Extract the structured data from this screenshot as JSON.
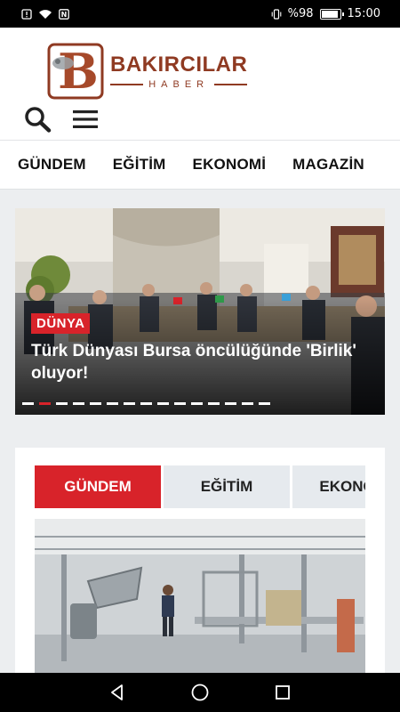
{
  "status_bar": {
    "battery": "%98",
    "time": "15:00"
  },
  "header": {
    "logo_letter": "B",
    "logo_name": "BAKIRCILAR",
    "logo_sub": "HABER"
  },
  "category_nav": {
    "items": [
      "GÜNDEM",
      "EĞİTİM",
      "EKONOMİ",
      "MAGAZİN"
    ]
  },
  "slider": {
    "category": "DÜNYA",
    "title": "Türk Dünyası Bursa öncülüğünde 'Birlik' oluyor!",
    "slide_count": 15,
    "active_slide": 2
  },
  "tabs_card": {
    "tabs": [
      "GÜNDEM",
      "EĞİTİM",
      "EKONOMİ"
    ],
    "active_tab": 0
  },
  "colors": {
    "accent": "#d8232a",
    "brand": "#8f3a22"
  }
}
